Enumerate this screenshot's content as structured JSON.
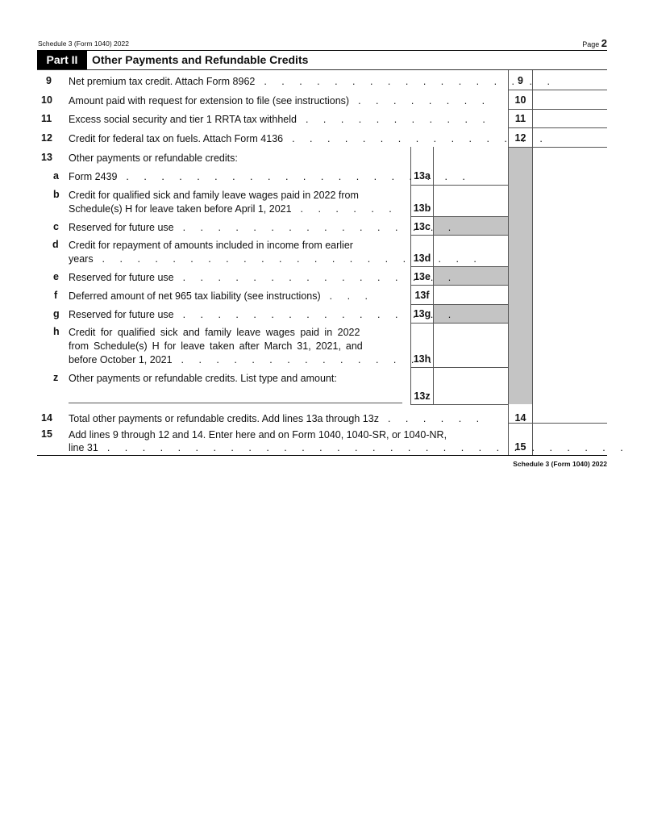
{
  "header": {
    "form_id": "Schedule 3 (Form 1040) 2022",
    "page_label": "Page",
    "page_number": "2"
  },
  "part": {
    "tag": "Part II",
    "title": "Other Payments and Refundable Credits"
  },
  "lines": {
    "l9": {
      "num": "9",
      "text": "Net premium tax credit. Attach Form 8962",
      "box": "9"
    },
    "l10": {
      "num": "10",
      "text": "Amount paid with request for extension to file (see instructions)",
      "box": "10"
    },
    "l11": {
      "num": "11",
      "text": "Excess social security and tier 1 RRTA tax withheld",
      "box": "11"
    },
    "l12": {
      "num": "12",
      "text": "Credit for federal tax on fuels. Attach Form 4136",
      "box": "12"
    },
    "l13": {
      "num": "13",
      "text": "Other payments or refundable credits:"
    },
    "l13a": {
      "num": "a",
      "text": "Form 2439",
      "box": "13a"
    },
    "l13b": {
      "num": "b",
      "text1": "Credit for qualified sick and family leave wages paid in 2022 from",
      "text2": "Schedule(s) H for leave taken before April 1, 2021",
      "box": "13b"
    },
    "l13c": {
      "num": "c",
      "text": "Reserved for future use",
      "box": "13c"
    },
    "l13d": {
      "num": "d",
      "text1": "Credit for repayment of amounts included in income from earlier",
      "text2": "years",
      "box": "13d"
    },
    "l13e": {
      "num": "e",
      "text": "Reserved for future use",
      "box": "13e"
    },
    "l13f": {
      "num": "f",
      "text": "Deferred amount of net 965 tax liability (see instructions)",
      "box": "13f"
    },
    "l13g": {
      "num": "g",
      "text": "Reserved for future use",
      "box": "13g"
    },
    "l13h": {
      "num": "h",
      "text1": "Credit for qualified sick and family leave wages paid in 2022",
      "text2": "from Schedule(s) H for leave taken after March 31, 2021, and",
      "text3": "before October 1, 2021",
      "box": "13h"
    },
    "l13z": {
      "num": "z",
      "text": "Other payments or refundable credits. List type and amount:",
      "box": "13z",
      "list_value": ""
    },
    "l14": {
      "num": "14",
      "text": "Total other payments or refundable credits. Add lines 13a through 13z",
      "box": "14"
    },
    "l15": {
      "num": "15",
      "text1": "Add lines 9 through 12 and 14. Enter here and on Form 1040, 1040-SR, or 1040-NR,",
      "text2": "line 31",
      "box": "15"
    }
  },
  "amounts": {
    "l9": "",
    "l10": "",
    "l11": "",
    "l12": "",
    "l13a": "",
    "l13b": "",
    "l13d": "",
    "l13f": "",
    "l13h": "",
    "l13z": "",
    "l14": "",
    "l15": ""
  },
  "footer": {
    "form_id": "Schedule 3 (Form 1040) 2022"
  },
  "colors": {
    "shade": "#c4c4c4",
    "part_tag_bg": "#000000"
  }
}
